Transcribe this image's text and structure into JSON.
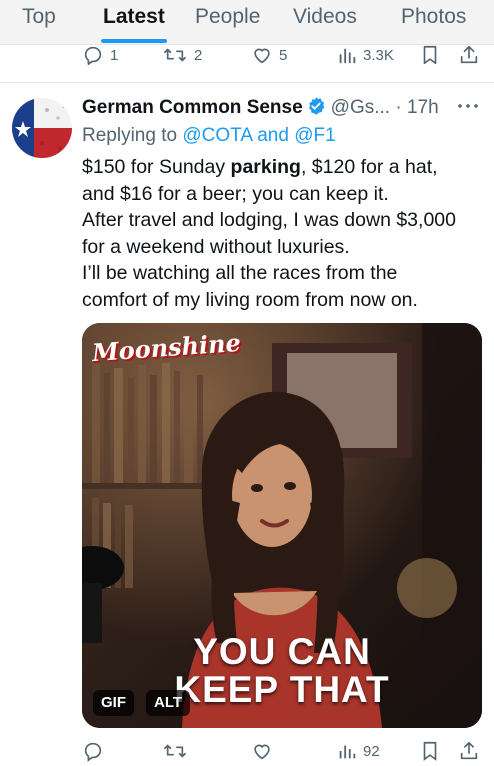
{
  "tabs": {
    "items": [
      {
        "label": "Top",
        "active": false
      },
      {
        "label": "Latest",
        "active": true
      },
      {
        "label": "People",
        "active": false
      },
      {
        "label": "Videos",
        "active": false
      },
      {
        "label": "Photos",
        "active": false
      }
    ],
    "accent": "#1d9bf0"
  },
  "prev_actions": {
    "reply_count": "1",
    "retweet_count": "2",
    "like_count": "5",
    "view_count": "3.3K"
  },
  "tweet": {
    "author_name": "German Common Sense",
    "handle_time": "@Gs... · 17h",
    "more_icon": "more-icon",
    "reply_prefix": "Replying to",
    "reply_mentions": "@COTA and @F1",
    "body": {
      "line1_part1": "$150 for Sunday ",
      "line1_bold": "parking",
      "line1_part2": ", $120 for a hat,",
      "line2": "and $16 for a beer; you can keep it.",
      "line3": "After travel and lodging, I was down $3,000",
      "line4": "for a weekend without luxuries.",
      "line5": "I’ll be watching all the races from the",
      "line6": "comfort of my living room from now on."
    },
    "media": {
      "logo": "Moonshine",
      "caption_line1": "YOU CAN",
      "caption_line2": "KEEP THAT",
      "gif_badge": "GIF",
      "alt_badge": "ALT"
    },
    "actions": {
      "view_count": "92"
    }
  },
  "colors": {
    "verified": "#1d9bf0",
    "muted": "#536471",
    "link": "#1d9bf0"
  }
}
